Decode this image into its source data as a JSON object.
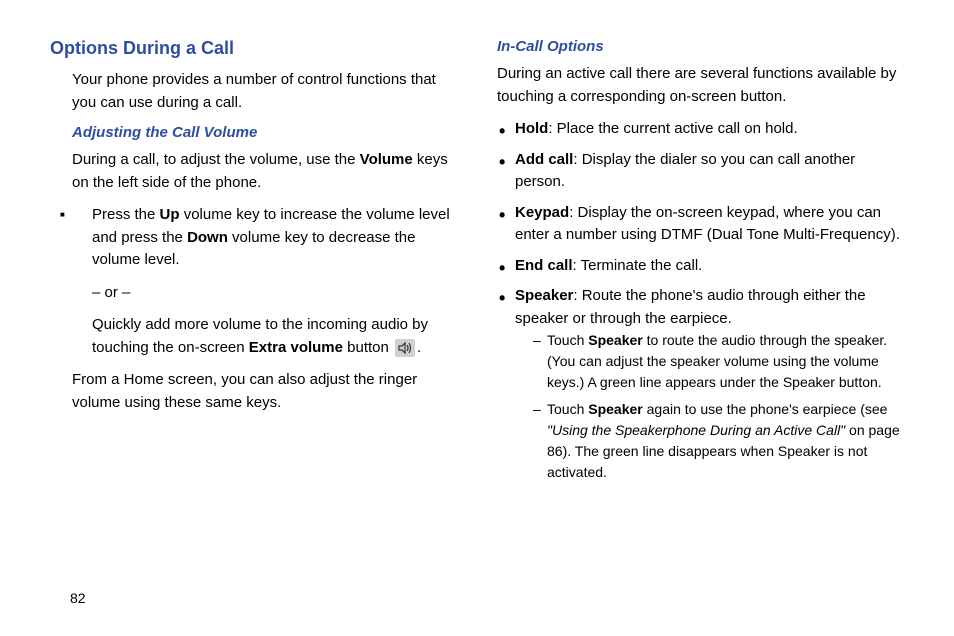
{
  "left_column": {
    "heading1": "Options During a Call",
    "intro": "Your phone provides a number of control functions that you can use during a call.",
    "heading2": "Adjusting the Call Volume",
    "para1_pre": "During a call, to adjust the volume, use the ",
    "para1_bold": "Volume",
    "para1_post": " keys on the left side of the phone.",
    "bullet1_pre": "Press the ",
    "bullet1_bold1": "Up",
    "bullet1_mid": " volume key to increase the volume level and press the ",
    "bullet1_bold2": "Down",
    "bullet1_post": " volume key to decrease the volume level.",
    "or_text": "– or –",
    "bullet2_pre": "Quickly add more volume to the incoming audio by touching the on-screen ",
    "bullet2_bold": "Extra volume",
    "bullet2_mid": " button ",
    "bullet2_post": ".",
    "para2": "From a Home screen, you can also adjust the ringer volume using these same keys."
  },
  "right_column": {
    "heading2": "In-Call Options",
    "intro": "During an active call there are several functions available by touching a corresponding on-screen button.",
    "items": [
      {
        "bold": "Hold",
        "text": ": Place the current active call on hold."
      },
      {
        "bold": "Add call",
        "text": ": Display the dialer so you can call another person."
      },
      {
        "bold": "Keypad",
        "text": ": Display the on-screen keypad, where you can enter a number using DTMF (Dual Tone Multi-Frequency)."
      },
      {
        "bold": "End call",
        "text": ": Terminate the call."
      }
    ],
    "speaker_bold": "Speaker",
    "speaker_text": ": Route the phone's audio through either the speaker or through the earpiece.",
    "dash1_pre": "Touch ",
    "dash1_bold": "Speaker",
    "dash1_post": " to route the audio through the speaker. (You can adjust the speaker volume using the volume keys.) A green line appears under the Speaker button.",
    "dash2_pre": "Touch ",
    "dash2_bold": "Speaker",
    "dash2_mid": " again to use the phone's earpiece (see ",
    "dash2_italic": "\"Using the Speakerphone During an Active Call\"",
    "dash2_post": " on page 86). The green line disappears when Speaker is not activated."
  },
  "page_number": "82"
}
